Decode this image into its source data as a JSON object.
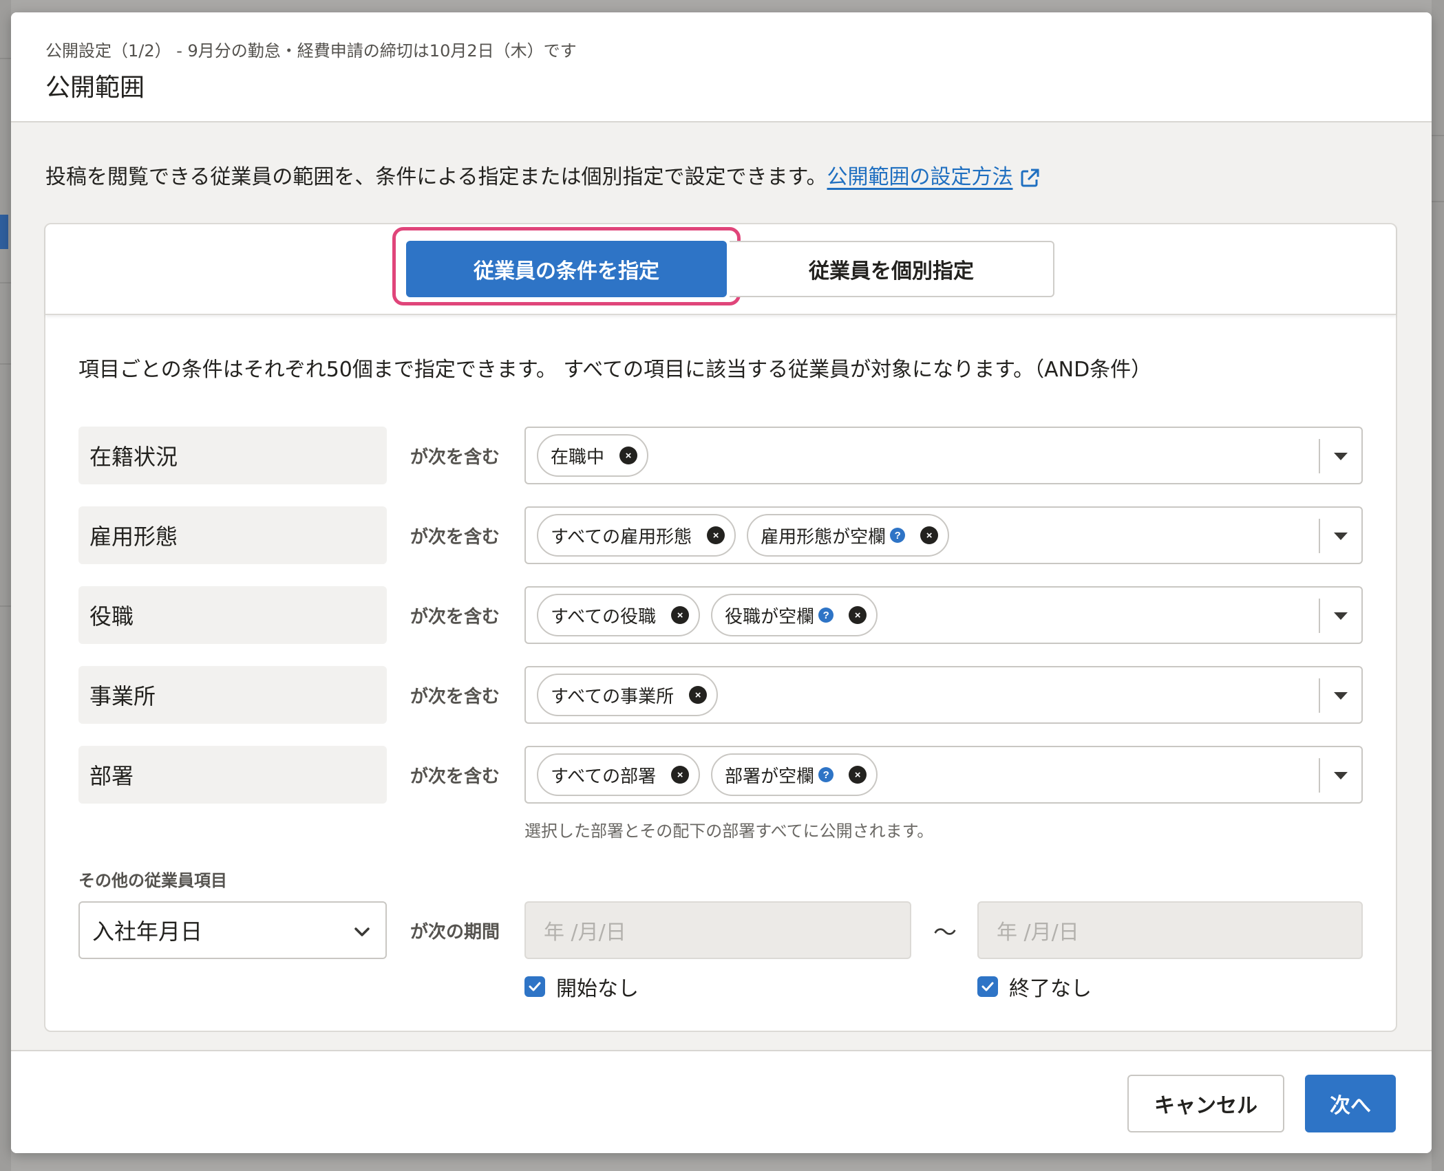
{
  "header": {
    "subtitle": "公開設定（1/2） - 9月分の勤怠・経費申請の締切は10月2日（木）です",
    "title": "公開範囲"
  },
  "intro": {
    "text": "投稿を閲覧できる従業員の範囲を、条件による指定または個別指定で設定できます。",
    "link": "公開範囲の設定方法"
  },
  "tabs": {
    "conditions": "従業員の条件を指定",
    "individual": "従業員を個別指定"
  },
  "description": "項目ごとの条件はそれぞれ50個まで指定できます。 すべての項目に該当する従業員が対象になります。（AND条件）",
  "conditions": [
    {
      "label": "在籍状況",
      "operator": "が次を含む",
      "chips": [
        {
          "text": "在職中",
          "help": false
        }
      ]
    },
    {
      "label": "雇用形態",
      "operator": "が次を含む",
      "chips": [
        {
          "text": "すべての雇用形態",
          "help": false
        },
        {
          "text": "雇用形態が空欄",
          "help": true
        }
      ]
    },
    {
      "label": "役職",
      "operator": "が次を含む",
      "chips": [
        {
          "text": "すべての役職",
          "help": false
        },
        {
          "text": "役職が空欄",
          "help": true
        }
      ]
    },
    {
      "label": "事業所",
      "operator": "が次を含む",
      "chips": [
        {
          "text": "すべての事業所",
          "help": false
        }
      ]
    },
    {
      "label": "部署",
      "operator": "が次を含む",
      "chips": [
        {
          "text": "すべての部署",
          "help": false
        },
        {
          "text": "部署が空欄",
          "help": true
        }
      ]
    }
  ],
  "help_glyph": "?",
  "remove_glyph": "×",
  "department_hint": "選択した部署とその配下の部署すべてに公開されます。",
  "other": {
    "label": "その他の従業員項目",
    "selected": "入社年月日",
    "operator": "が次の期間",
    "start_placeholder": "年 /月/日",
    "end_placeholder": "年 /月/日",
    "separator": "〜",
    "no_start": "開始なし",
    "no_end": "終了なし",
    "no_start_checked": true,
    "no_end_checked": true
  },
  "footer": {
    "cancel": "キャンセル",
    "next": "次へ"
  },
  "colors": {
    "primary": "#2e74c6",
    "highlight": "#e0457a",
    "link": "#1f6fc0"
  }
}
